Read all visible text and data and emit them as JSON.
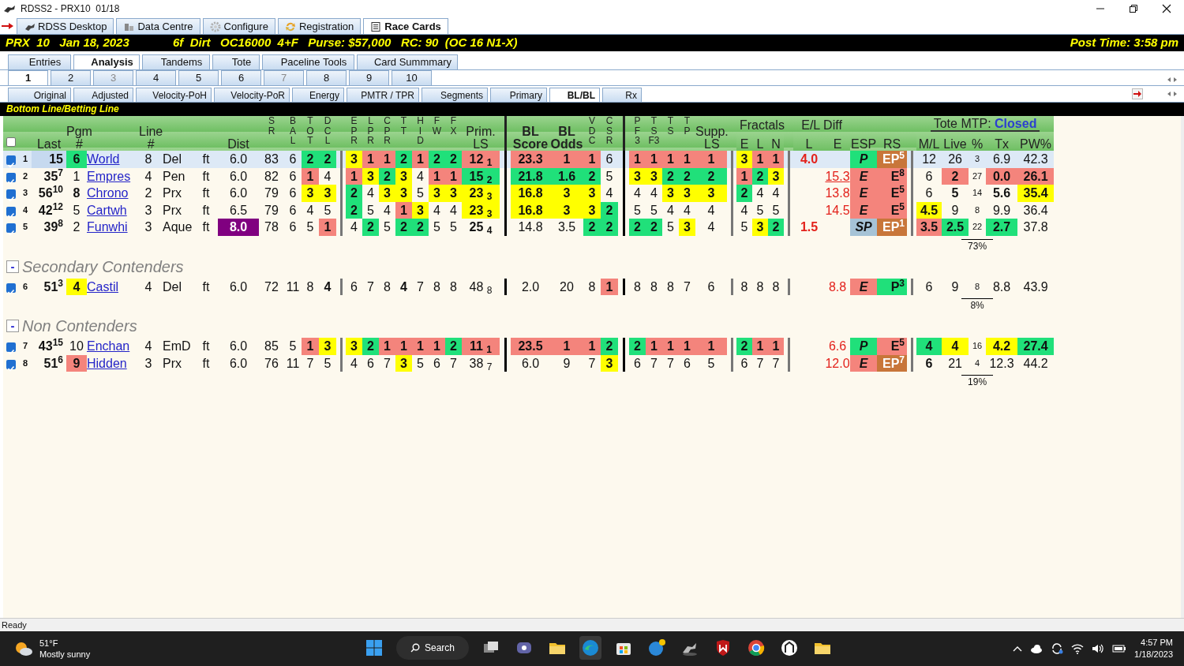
{
  "window": {
    "title": "RDSS2 - PRX10  01/18"
  },
  "app_tabs": [
    {
      "label": "RDSS Desktop",
      "selected": false
    },
    {
      "label": "Data Centre",
      "selected": false
    },
    {
      "label": "Configure",
      "selected": false
    },
    {
      "label": "Registration",
      "selected": false
    },
    {
      "label": "Race Cards",
      "selected": true
    }
  ],
  "race_header": {
    "race": "PRX  10   Jan 18, 2023",
    "conditions": "6f  Dirt   OC16000  4+F   Purse: $57,000   RC: 90  (OC 16 N1-X)",
    "post_time": "Post Time: 3:58 pm"
  },
  "view_tabs": [
    {
      "label": "Entries",
      "selected": false
    },
    {
      "label": "Analysis",
      "selected": true
    },
    {
      "label": "Tandems",
      "selected": false
    },
    {
      "label": "Tote",
      "selected": false
    },
    {
      "label": "Paceline Tools",
      "selected": false
    },
    {
      "label": "Card Summmary",
      "selected": false
    }
  ],
  "race_tabs": [
    {
      "label": "1",
      "selected": true,
      "disabled": false
    },
    {
      "label": "2",
      "selected": false,
      "disabled": false
    },
    {
      "label": "3",
      "selected": false,
      "disabled": true
    },
    {
      "label": "4",
      "selected": false,
      "disabled": false
    },
    {
      "label": "5",
      "selected": false,
      "disabled": false
    },
    {
      "label": "6",
      "selected": false,
      "disabled": false
    },
    {
      "label": "7",
      "selected": false,
      "disabled": true
    },
    {
      "label": "8",
      "selected": false,
      "disabled": false
    },
    {
      "label": "9",
      "selected": false,
      "disabled": false
    },
    {
      "label": "10",
      "selected": false,
      "disabled": false
    }
  ],
  "method_tabs": [
    {
      "label": "Original",
      "selected": false
    },
    {
      "label": "Adjusted",
      "selected": false
    },
    {
      "label": "Velocity-PoH",
      "selected": false
    },
    {
      "label": "Velocity-PoR",
      "selected": false
    },
    {
      "label": "Energy",
      "selected": false
    },
    {
      "label": "PMTR / TPR",
      "selected": false
    },
    {
      "label": "Segments",
      "selected": false
    },
    {
      "label": "Primary",
      "selected": false
    },
    {
      "label": "BL/BL",
      "selected": true
    },
    {
      "label": "Rx",
      "selected": false
    }
  ],
  "panel_title": "Bottom Line/Betting Line",
  "table": {
    "select_all": {
      "checked": false
    },
    "columns": [
      {
        "label": "Last",
        "kind": "last"
      },
      {
        "label": "Pgm #",
        "kind": "text"
      },
      {
        "kind": "link"
      },
      {
        "label": "Line #",
        "kind": "text"
      },
      {
        "kind": "left"
      },
      {
        "kind": "text"
      },
      {
        "label": "Dist",
        "kind": "text"
      },
      {
        "label": "S R",
        "kind": "text"
      },
      {
        "label": "B A L",
        "kind": "text"
      },
      {
        "label": "T O T",
        "kind": "text"
      },
      {
        "label": "D C L",
        "kind": "text",
        "divider": true,
        "heavy": false
      },
      {
        "label": "E P R",
        "kind": "text"
      },
      {
        "label": "L P R",
        "kind": "text"
      },
      {
        "label": "C P R",
        "kind": "text"
      },
      {
        "label": "T T",
        "kind": "text"
      },
      {
        "label": "H I D",
        "kind": "text"
      },
      {
        "label": "F W",
        "kind": "text"
      },
      {
        "label": "F X",
        "kind": "text"
      },
      {
        "label": "Prim. LS",
        "kind": "text",
        "divider": true,
        "heavy": true
      },
      {
        "label": "BL Score",
        "kind": "text"
      },
      {
        "label": "BL Odds",
        "kind": "text"
      },
      {
        "label": "V D C",
        "kind": "text"
      },
      {
        "label": "C S R",
        "kind": "text",
        "divider": true,
        "heavy": true
      },
      {
        "label": "P F 3",
        "kind": "text"
      },
      {
        "label": "T S F3",
        "kind": "text"
      },
      {
        "label": "T S",
        "kind": "text"
      },
      {
        "label": "T P",
        "kind": "text"
      },
      {
        "label": "Supp. LS",
        "kind": "text",
        "divider": true,
        "heavy": false
      },
      {
        "group": "Fractals",
        "divider": true,
        "heavy": false,
        "columns": [
          {
            "label": "E",
            "kind": "text"
          },
          {
            "label": "L",
            "kind": "text"
          },
          {
            "label": "N",
            "kind": "text"
          }
        ]
      },
      {
        "group": "E/L Diff",
        "columns": [
          {
            "label": "L",
            "kind": "diff"
          },
          {
            "label": "E",
            "kind": "diff"
          }
        ]
      },
      {
        "label": "ESP",
        "kind": "esp"
      },
      {
        "label": "RS",
        "kind": "rs",
        "divider": true,
        "heavy": false
      },
      {
        "group": "Tote MTP:",
        "status": "Closed",
        "columns": [
          {
            "label": "M/L",
            "kind": "text"
          },
          {
            "label": "Live",
            "kind": "text"
          },
          {
            "label": "%",
            "kind": "small"
          },
          {
            "label": "Tx",
            "kind": "text"
          },
          {
            "label": "PW%",
            "kind": "text"
          }
        ]
      }
    ],
    "sections": [
      {
        "rows": [
          {
            "number": "1",
            "checked": true,
            "selected": true,
            "cells": [
              {
                "text": "15",
                "color": "#c6d9ef"
              },
              {
                "text": "6",
                "color": "#20e07a"
              },
              "World",
              "8",
              "Del",
              "ft",
              "6.0",
              "83",
              "6",
              {
                "text": "2",
                "color": "#20e07a"
              },
              {
                "text": "2",
                "color": "#20e07a"
              },
              {
                "text": "3",
                "color": "#ffff00"
              },
              {
                "text": "1",
                "color": "#f4847c"
              },
              {
                "text": "1",
                "color": "#f4847c"
              },
              {
                "text": "2",
                "color": "#20e07a"
              },
              {
                "text": "1",
                "color": "#f4847c"
              },
              {
                "text": "2",
                "color": "#20e07a"
              },
              {
                "text": "2",
                "color": "#20e07a"
              },
              {
                "text": "12 $_{1}$",
                "color": "#f4847c"
              },
              {
                "text": "23.3",
                "color": "#f4847c"
              },
              {
                "text": "1",
                "color": "#f4847c"
              },
              {
                "text": "1",
                "color": "#f4847c"
              },
              "6",
              {
                "text": "1",
                "color": "#f4847c"
              },
              {
                "text": "1",
                "color": "#f4847c"
              },
              {
                "text": "1",
                "color": "#f4847c"
              },
              {
                "text": "1",
                "color": "#f4847c"
              },
              {
                "text": "1",
                "color": "#f4847c"
              },
              {
                "text": "3",
                "color": "#ffff00"
              },
              {
                "text": "1",
                "color": "#f4847c"
              },
              {
                "text": "1",
                "color": "#f4847c"
              },
              {
                "text": "4.0",
                "bold": true
              },
              null,
              {
                "text": "P",
                "color": "#20e07a"
              },
              {
                "text": "EP$^{5}$",
                "color": "#c8763a"
              },
              "12",
              "26",
              "3",
              "6.9",
              "42.3"
            ]
          },
          {
            "number": "2",
            "checked": true,
            "selected": false,
            "cells": [
              "35$^{7}$",
              "1",
              "Empres",
              "4",
              "Pen",
              "ft",
              "6.0",
              "82",
              "6",
              {
                "text": "1",
                "color": "#f4847c"
              },
              "4",
              {
                "text": "1",
                "color": "#f4847c"
              },
              {
                "text": "3",
                "color": "#ffff00"
              },
              {
                "text": "2",
                "color": "#20e07a"
              },
              {
                "text": "3",
                "color": "#ffff00"
              },
              "4",
              {
                "text": "1",
                "color": "#f4847c"
              },
              {
                "text": "1",
                "color": "#f4847c"
              },
              {
                "text": "15 $_{2}$",
                "color": "#20e07a"
              },
              {
                "text": "21.8",
                "color": "#20e07a"
              },
              {
                "text": "1.6",
                "color": "#20e07a"
              },
              {
                "text": "2",
                "color": "#20e07a"
              },
              "5",
              {
                "text": "3",
                "color": "#ffff00"
              },
              {
                "text": "3",
                "color": "#ffff00"
              },
              {
                "text": "2",
                "color": "#20e07a"
              },
              {
                "text": "2",
                "color": "#20e07a"
              },
              {
                "text": "2",
                "color": "#20e07a"
              },
              {
                "text": "1",
                "color": "#f4847c"
              },
              {
                "text": "2",
                "color": "#20e07a"
              },
              {
                "text": "3",
                "color": "#ffff00"
              },
              null,
              {
                "text": "15.3",
                "underline": true
              },
              {
                "text": "E",
                "color": "#f4847c"
              },
              {
                "text": "E$^{8}$",
                "color": "#f4847c"
              },
              "6",
              {
                "text": "2",
                "color": "#f4847c"
              },
              "27",
              {
                "text": "0.0",
                "color": "#f4847c"
              },
              {
                "text": "26.1",
                "color": "#f4847c"
              }
            ]
          },
          {
            "number": "3",
            "checked": true,
            "selected": false,
            "cells": [
              "56$^{10}$",
              {
                "text": "8",
                "bold": true
              },
              "Chrono",
              "2",
              "Prx",
              "ft",
              "6.0",
              "79",
              "6",
              {
                "text": "3",
                "color": "#ffff00"
              },
              {
                "text": "3",
                "color": "#ffff00"
              },
              {
                "text": "2",
                "color": "#20e07a"
              },
              "4",
              {
                "text": "3",
                "color": "#ffff00"
              },
              {
                "text": "3",
                "color": "#ffff00"
              },
              "5",
              {
                "text": "3",
                "color": "#ffff00"
              },
              {
                "text": "3",
                "color": "#ffff00"
              },
              {
                "text": "23 $_{3}$",
                "color": "#ffff00"
              },
              {
                "text": "16.8",
                "color": "#ffff00"
              },
              {
                "text": "3",
                "color": "#ffff00"
              },
              {
                "text": "3",
                "color": "#ffff00"
              },
              "4",
              "4",
              "4",
              {
                "text": "3",
                "color": "#ffff00"
              },
              {
                "text": "3",
                "color": "#ffff00"
              },
              {
                "text": "3",
                "color": "#ffff00"
              },
              {
                "text": "2",
                "color": "#20e07a"
              },
              "4",
              "4",
              null,
              "13.8",
              {
                "text": "E",
                "color": "#f4847c"
              },
              {
                "text": "E$^{5}$",
                "color": "#f4847c"
              },
              "6",
              {
                "text": "5",
                "bold": true
              },
              "14",
              {
                "text": "5.6",
                "bold": true
              },
              {
                "text": "35.4",
                "color": "#ffff00"
              }
            ]
          },
          {
            "number": "4",
            "checked": true,
            "selected": false,
            "cells": [
              "42$^{12}$",
              "5",
              "Cartwh",
              "3",
              "Prx",
              "ft",
              "6.5",
              "79",
              "6",
              "4",
              "5",
              {
                "text": "2",
                "color": "#20e07a"
              },
              "5",
              "4",
              {
                "text": "1",
                "color": "#f4847c"
              },
              {
                "text": "3",
                "color": "#ffff00"
              },
              "4",
              "4",
              {
                "text": "23 $_{3}$",
                "color": "#ffff00"
              },
              {
                "text": "16.8",
                "color": "#ffff00"
              },
              {
                "text": "3",
                "color": "#ffff00"
              },
              {
                "text": "3",
                "color": "#ffff00"
              },
              {
                "text": "2",
                "color": "#20e07a"
              },
              "5",
              "5",
              "4",
              "4",
              "4",
              "4",
              "5",
              "5",
              null,
              "14.5",
              {
                "text": "E",
                "color": "#f4847c"
              },
              {
                "text": "E$^{5}$",
                "color": "#f4847c"
              },
              {
                "text": "4.5",
                "color": "#ffff00"
              },
              "9",
              "8",
              "9.9",
              "36.4"
            ]
          },
          {
            "number": "5",
            "checked": true,
            "selected": false,
            "total": "73%",
            "cells": [
              "39$^{8}$",
              "2",
              "Funwhi",
              "3",
              "Aque",
              "ft",
              {
                "text": "8.0",
                "color": "#800080"
              },
              "78",
              "6",
              "5",
              {
                "text": "1",
                "color": "#f4847c"
              },
              "4",
              {
                "text": "2",
                "color": "#20e07a"
              },
              "5",
              {
                "text": "2",
                "color": "#20e07a"
              },
              {
                "text": "2",
                "color": "#20e07a"
              },
              "5",
              "5",
              {
                "text": "25 $_{4}$",
                "bold": true
              },
              "14.8",
              "3.5",
              {
                "text": "2",
                "color": "#20e07a"
              },
              {
                "text": "2",
                "color": "#20e07a"
              },
              {
                "text": "2",
                "color": "#20e07a"
              },
              {
                "text": "2",
                "color": "#20e07a"
              },
              "5",
              {
                "text": "3",
                "color": "#ffff00"
              },
              "4",
              "5",
              {
                "text": "3",
                "color": "#ffff00"
              },
              {
                "text": "2",
                "color": "#20e07a"
              },
              {
                "text": "1.5",
                "bold": true
              },
              null,
              {
                "text": "SP",
                "color": "#a6c3d6"
              },
              {
                "text": "EP$^{1}$",
                "color": "#c8763a"
              },
              {
                "text": "3.5",
                "color": "#f4847c"
              },
              {
                "text": "2.5",
                "color": "#20e07a"
              },
              "22",
              {
                "text": "2.7",
                "color": "#20e07a"
              },
              "37.8"
            ]
          }
        ]
      },
      {
        "title": "Secondary Contenders",
        "toggle": "-",
        "rows": [
          {
            "number": "6",
            "checked": true,
            "selected": false,
            "total": "8%",
            "cells": [
              "51$^{3}$",
              {
                "text": "4",
                "color": "#ffff00"
              },
              "Castil",
              "4",
              "Del",
              "ft",
              "6.0",
              "72",
              "11",
              "8",
              {
                "text": "4",
                "bold": true
              },
              "6",
              "7",
              "8",
              {
                "text": "4",
                "bold": true
              },
              "7",
              "8",
              "8",
              "48 $_{8}$",
              "2.0",
              "20",
              "8",
              {
                "text": "1",
                "color": "#f4847c"
              },
              "8",
              "8",
              "8",
              "7",
              "6",
              "8",
              "8",
              "8",
              null,
              "8.8",
              {
                "text": "E",
                "color": "#f4847c"
              },
              {
                "text": "P$^{3}$",
                "color": "#20e07a"
              },
              "6",
              "9",
              "8",
              "8.8",
              "43.9"
            ]
          }
        ]
      },
      {
        "title": "Non Contenders",
        "toggle": "-",
        "rows": [
          {
            "number": "7",
            "checked": true,
            "selected": false,
            "cells": [
              "43$^{15}$",
              "10",
              "Enchan",
              "4",
              "EmD",
              "ft",
              "6.0",
              "85",
              "5",
              {
                "text": "1",
                "color": "#f4847c"
              },
              {
                "text": "3",
                "color": "#ffff00"
              },
              {
                "text": "3",
                "color": "#ffff00"
              },
              {
                "text": "2",
                "color": "#20e07a"
              },
              {
                "text": "1",
                "color": "#f4847c"
              },
              {
                "text": "1",
                "color": "#f4847c"
              },
              {
                "text": "1",
                "color": "#f4847c"
              },
              {
                "text": "1",
                "color": "#f4847c"
              },
              {
                "text": "2",
                "color": "#20e07a"
              },
              {
                "text": "11 $_{1}$",
                "color": "#f4847c"
              },
              {
                "text": "23.5",
                "color": "#f4847c"
              },
              {
                "text": "1",
                "color": "#f4847c"
              },
              {
                "text": "1",
                "color": "#f4847c"
              },
              {
                "text": "2",
                "color": "#20e07a"
              },
              {
                "text": "2",
                "color": "#20e07a"
              },
              {
                "text": "1",
                "color": "#f4847c"
              },
              {
                "text": "1",
                "color": "#f4847c"
              },
              {
                "text": "1",
                "color": "#f4847c"
              },
              {
                "text": "1",
                "color": "#f4847c"
              },
              {
                "text": "2",
                "color": "#20e07a"
              },
              {
                "text": "1",
                "color": "#f4847c"
              },
              {
                "text": "1",
                "color": "#f4847c"
              },
              null,
              "6.6",
              {
                "text": "P",
                "color": "#20e07a"
              },
              {
                "text": "E$^{5}$",
                "color": "#f4847c"
              },
              {
                "text": "4",
                "color": "#20e07a"
              },
              {
                "text": "4",
                "color": "#ffff00"
              },
              "16",
              {
                "text": "4.2",
                "color": "#ffff00"
              },
              {
                "text": "27.4",
                "color": "#20e07a"
              }
            ]
          },
          {
            "number": "8",
            "checked": true,
            "selected": false,
            "total": "19%",
            "cells": [
              "51$^{6}$",
              {
                "text": "9",
                "color": "#f4847c"
              },
              "Hidden",
              "3",
              "Prx",
              "ft",
              "6.0",
              "76",
              "11",
              "7",
              "5",
              "4",
              "6",
              "7",
              {
                "text": "3",
                "color": "#ffff00"
              },
              "5",
              "6",
              "7",
              "38 $_{7}$",
              "6.0",
              "9",
              "7",
              {
                "text": "3",
                "color": "#ffff00"
              },
              "6",
              "7",
              "7",
              "6",
              "5",
              "6",
              "7",
              "7",
              null,
              "12.0",
              {
                "text": "E",
                "color": "#f4847c"
              },
              {
                "text": "EP$^{7}$",
                "color": "#c8763a"
              },
              {
                "text": "6",
                "bold": true
              },
              "21",
              "4",
              "12.3",
              "44.2"
            ]
          }
        ]
      }
    ]
  },
  "status_bar": "Ready",
  "taskbar": {
    "temperature": "51°F",
    "weather": "Mostly sunny",
    "search": "Search",
    "time": "4:57 PM",
    "date": "1/18/2023"
  }
}
